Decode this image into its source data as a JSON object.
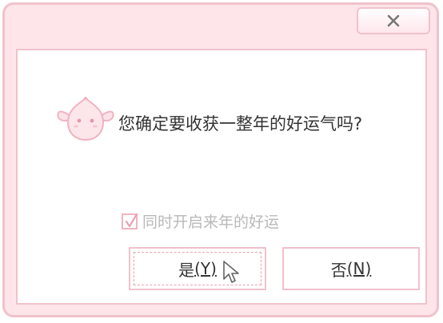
{
  "dialog": {
    "question": "您确定要收获一整年的好运气吗?",
    "close_symbol": "×",
    "checkbox": {
      "checked": true,
      "label": "同时开启来年的好运"
    },
    "buttons": {
      "yes": {
        "label": "是",
        "shortcut": "(Y)"
      },
      "no": {
        "label": "否",
        "shortcut": "(N)"
      }
    }
  },
  "colors": {
    "frame": "#fde5ea",
    "border": "#f0c2cb",
    "accent": "#f0b3c0",
    "text": "#333333",
    "muted_text": "#b9b9b9"
  },
  "icons": {
    "close": "close-icon",
    "mascot": "peach-mascot-icon",
    "check": "checkmark-icon",
    "cursor": "mouse-pointer-icon"
  }
}
